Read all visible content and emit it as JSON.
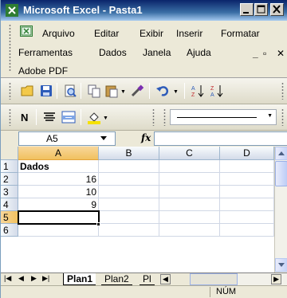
{
  "window": {
    "title": "Microsoft Excel - Pasta1"
  },
  "menu": {
    "arquivo": "Arquivo",
    "editar": "Editar",
    "exibir": "Exibir",
    "inserir": "Inserir",
    "formatar": "Formatar",
    "ferramentas": "Ferramentas",
    "dados": "Dados",
    "janela": "Janela",
    "ajuda": "Ajuda",
    "adobe_pdf": "Adobe PDF"
  },
  "formula_bar": {
    "name_box": "A5",
    "fx_label": "fx",
    "formula": ""
  },
  "columns": [
    "A",
    "B",
    "C",
    "D"
  ],
  "rows": [
    {
      "num": "1",
      "a": "Dados"
    },
    {
      "num": "2",
      "a": "16"
    },
    {
      "num": "3",
      "a": "10"
    },
    {
      "num": "4",
      "a": "9"
    },
    {
      "num": "5",
      "a": ""
    },
    {
      "num": "6",
      "a": ""
    }
  ],
  "selected_cell": "A5",
  "sheet_tabs": [
    "Plan1",
    "Plan2",
    "Pl"
  ],
  "active_sheet": "Plan1",
  "status": {
    "num_lock": "NÚM"
  },
  "colors": {
    "title_bar": "#0a246a",
    "header_selected": "#f1c15f",
    "grid_line": "#d0d7e5"
  },
  "icons": [
    "excel-app-icon",
    "new-icon",
    "save-icon",
    "print-preview-icon",
    "copy-icon",
    "paste-icon",
    "format-painter-icon",
    "undo-icon",
    "sort-ascending-icon",
    "sort-descending-icon",
    "bold-icon",
    "align-center-icon",
    "merge-center-icon",
    "fill-color-icon",
    "border-line-icon"
  ]
}
